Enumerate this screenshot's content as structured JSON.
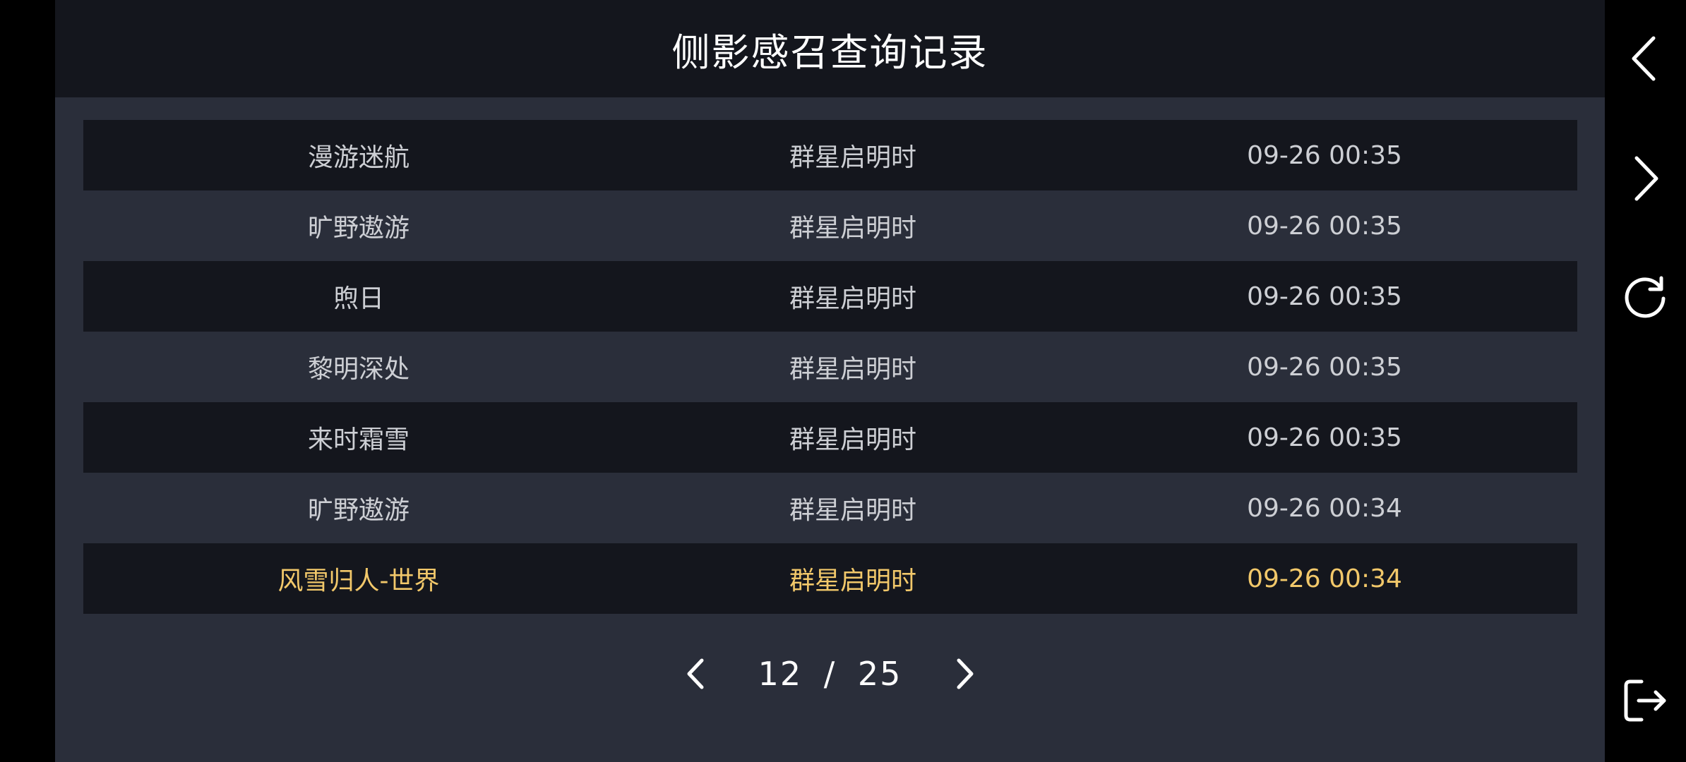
{
  "header": {
    "title": "侧影感召查询记录"
  },
  "records": [
    {
      "name": "漫游迷航",
      "pool": "群星启明时",
      "time": "09-26 00:35",
      "style": "dark"
    },
    {
      "name": "旷野遨游",
      "pool": "群星启明时",
      "time": "09-26 00:35",
      "style": "light"
    },
    {
      "name": "煦日",
      "pool": "群星启明时",
      "time": "09-26 00:35",
      "style": "dark"
    },
    {
      "name": "黎明深处",
      "pool": "群星启明时",
      "time": "09-26 00:35",
      "style": "light"
    },
    {
      "name": "来时霜雪",
      "pool": "群星启明时",
      "time": "09-26 00:35",
      "style": "dark"
    },
    {
      "name": "旷野遨游",
      "pool": "群星启明时",
      "time": "09-26 00:34",
      "style": "light"
    },
    {
      "name": "风雪归人-世界",
      "pool": "群星启明时",
      "time": "09-26 00:34",
      "style": "dark highlight"
    }
  ],
  "pagination": {
    "current": "12",
    "separator": "/",
    "total": "25"
  },
  "icons": {
    "back": "chevron-left-icon",
    "forward": "chevron-right-icon",
    "refresh": "refresh-icon",
    "exit": "logout-icon",
    "prev_page": "chevron-left-icon",
    "next_page": "chevron-right-icon"
  },
  "colors": {
    "background": "#2a2e3a",
    "row_dark": "#14161d",
    "text": "#cdcfd4",
    "highlight": "#f2c86a"
  }
}
